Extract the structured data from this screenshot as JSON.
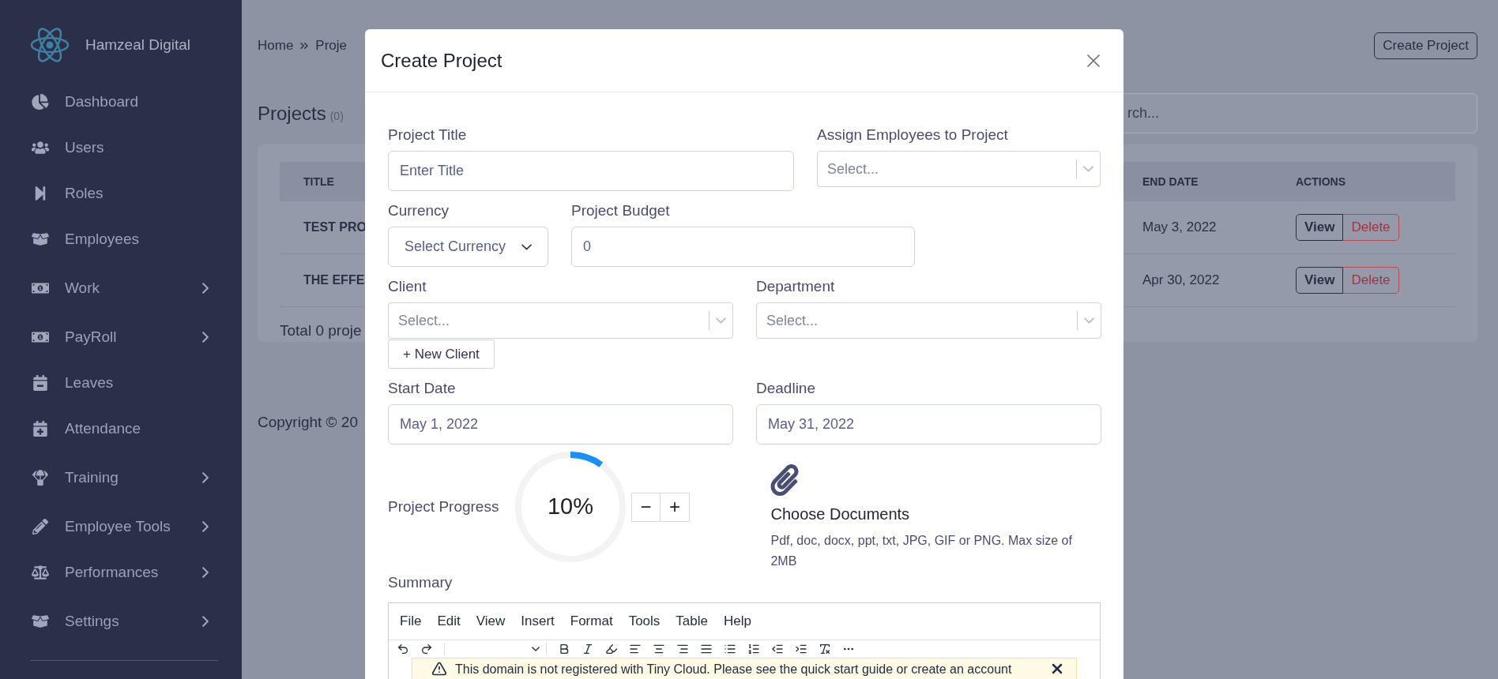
{
  "sidebar": {
    "brand": "Hamzeal Digital",
    "items": [
      {
        "label": "Dashboard",
        "has_children": false
      },
      {
        "label": "Users",
        "has_children": false
      },
      {
        "label": "Roles",
        "has_children": false
      },
      {
        "label": "Employees",
        "has_children": false
      },
      {
        "label": "Work",
        "has_children": true
      },
      {
        "label": "PayRoll",
        "has_children": true
      },
      {
        "label": "Leaves",
        "has_children": false
      },
      {
        "label": "Attendance",
        "has_children": false
      },
      {
        "label": "Training",
        "has_children": true
      },
      {
        "label": "Employee Tools",
        "has_children": true
      },
      {
        "label": "Performances",
        "has_children": true
      },
      {
        "label": "Settings",
        "has_children": true
      }
    ]
  },
  "page": {
    "breadcrumb": [
      "Home",
      "Proje"
    ],
    "create_button": "Create Project",
    "title": "Projects",
    "count": "(0)",
    "search": {
      "placeholder": "rch..."
    },
    "table": {
      "columns": [
        "TITLE",
        "END DATE",
        "ACTIONS"
      ],
      "rows": [
        {
          "title": "TEST PRO",
          "end_date": "May 3, 2022",
          "view": "View",
          "delete": "Delete"
        },
        {
          "title": "THE EFFE",
          "end_date": "Apr 30, 2022",
          "view": "View",
          "delete": "Delete"
        }
      ]
    },
    "total": "Total 0 proje",
    "copyright": "Copyright © 20"
  },
  "modal": {
    "title": "Create Project",
    "rows": [
      [
        {
          "kind": "text",
          "label": "Project Title",
          "placeholder": "Enter Title"
        },
        {
          "kind": "select",
          "label": "Assign Employees to Project",
          "placeholder": "Select..."
        }
      ],
      [
        {
          "kind": "dropdown",
          "label": "Currency",
          "value": "Select Currency"
        },
        {
          "kind": "text",
          "label": "Project Budget",
          "value": "0"
        }
      ],
      [
        {
          "kind": "select",
          "label": "Client",
          "placeholder": "Select...",
          "button": "+ New Client"
        },
        {
          "kind": "select",
          "label": "Department",
          "placeholder": "Select..."
        }
      ],
      [
        {
          "kind": "text",
          "label": "Start Date",
          "value": "May 1, 2022"
        },
        {
          "kind": "text",
          "label": "Deadline",
          "value": "May 31, 2022"
        }
      ]
    ],
    "progress": {
      "label": "Project Progress",
      "level": 0.1,
      "reading": "10%",
      "decrement": "−",
      "increment": "+"
    },
    "documents": {
      "title": "Choose Documents",
      "hint": "Pdf, doc, docx, ppt, txt, JPG, GIF or PNG. Max size of 2MB"
    },
    "summary": {
      "label": "Summary",
      "menu": [
        "File",
        "Edit",
        "View",
        "Insert",
        "Format",
        "Tools",
        "Table",
        "Help"
      ],
      "warning": "This domain is not registered with Tiny Cloud. Please see the quick start guide or create an account"
    }
  }
}
